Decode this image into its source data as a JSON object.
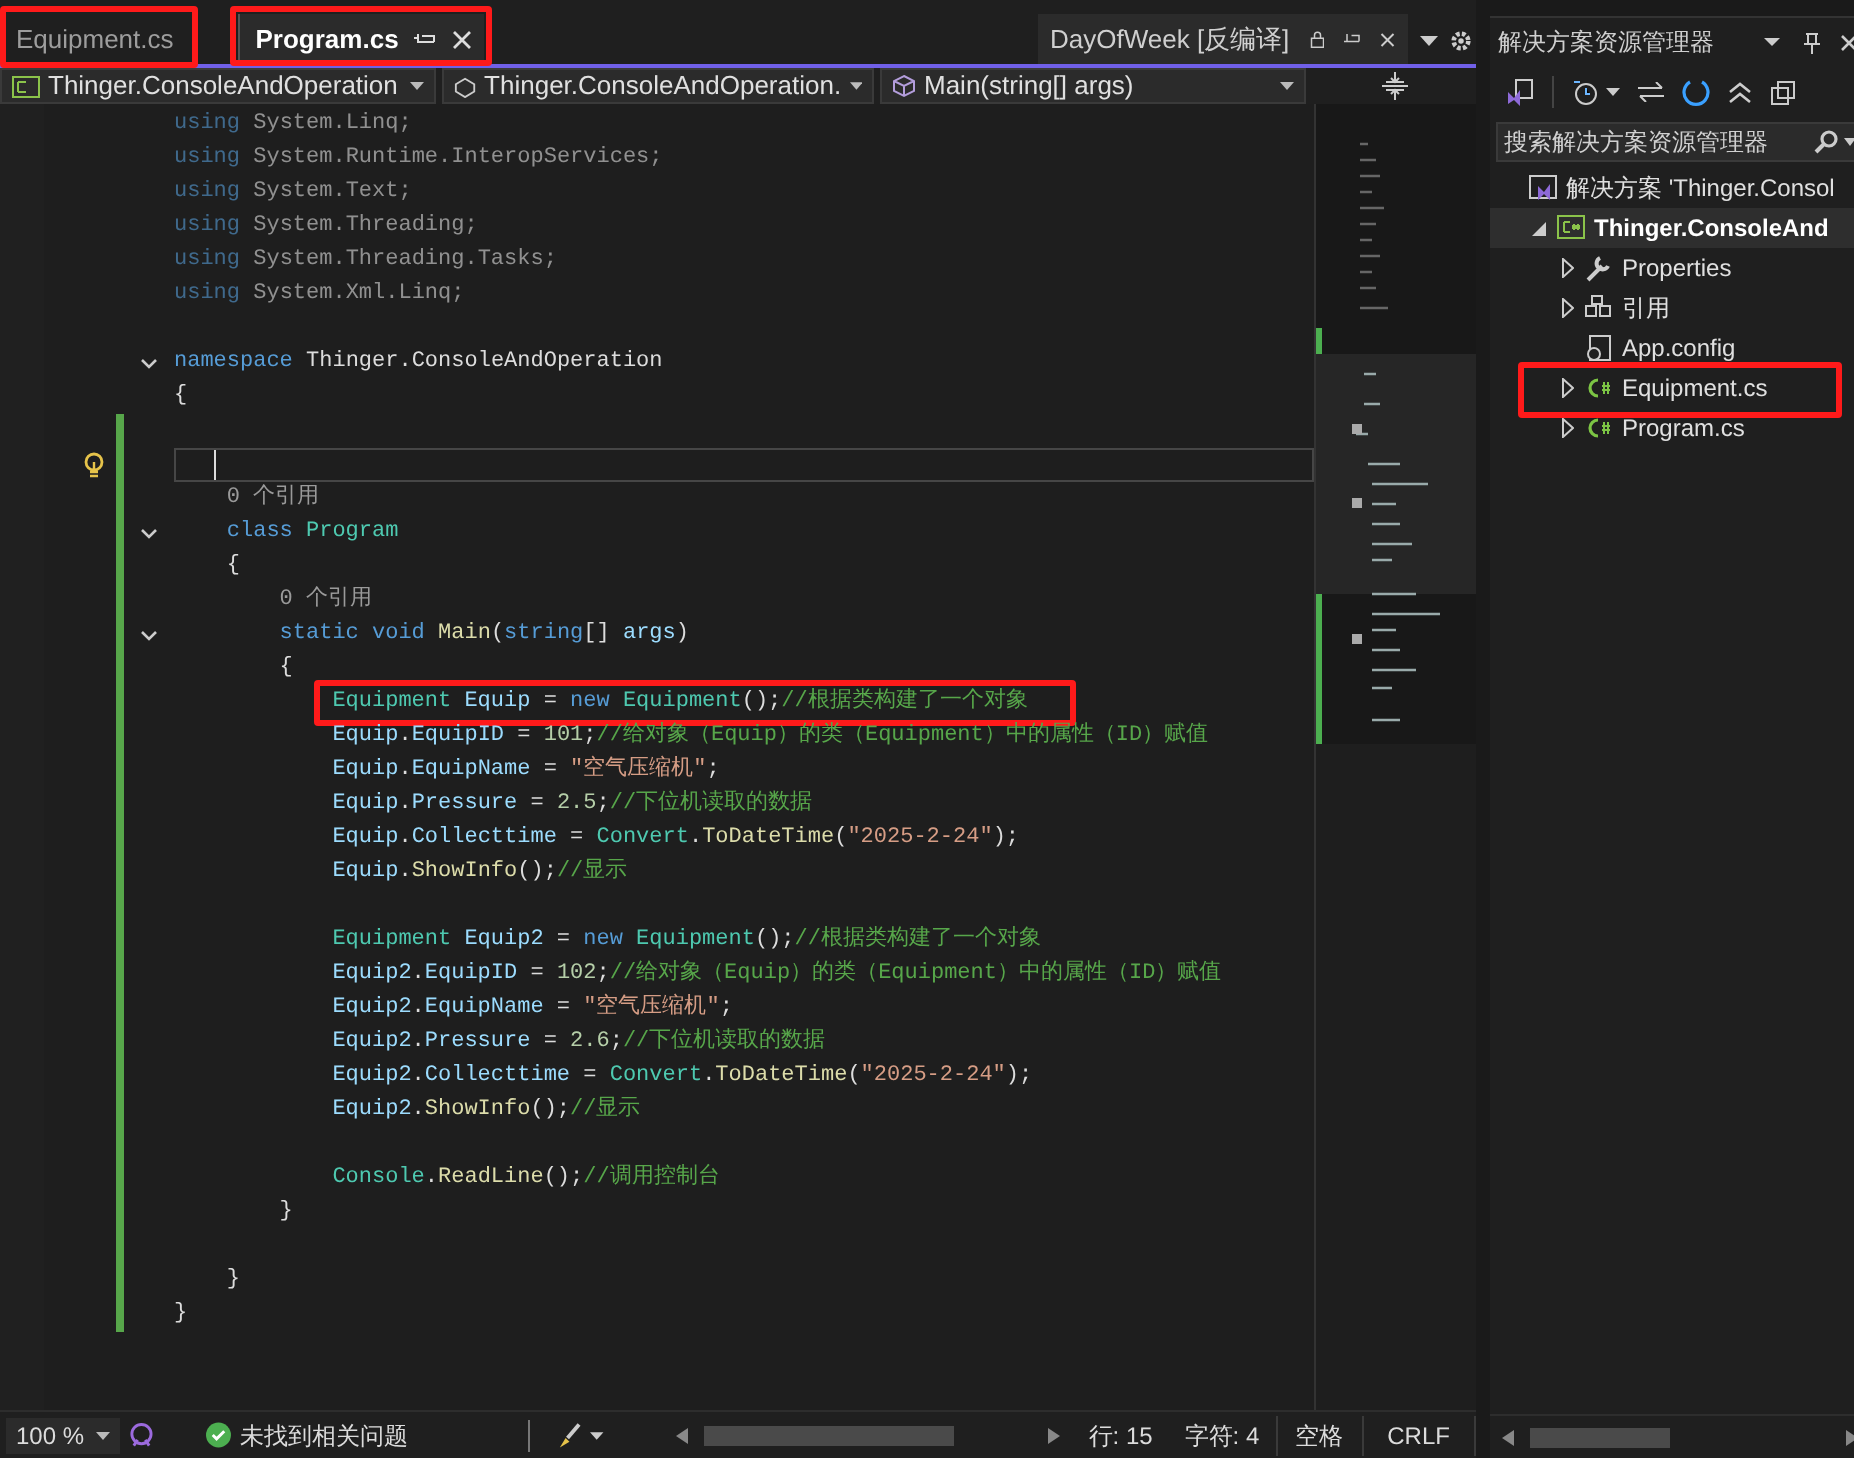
{
  "editor_tabs": [
    {
      "label": "Equipment.cs",
      "selected": false,
      "annotated": true
    },
    {
      "label": "Program.cs",
      "selected": true,
      "annotated": true
    }
  ],
  "preview_tab": {
    "label": "DayOfWeek [反编译]"
  },
  "navigation": [
    "Thinger.ConsoleAndOperation",
    "Thinger.ConsoleAndOperation.",
    "Main(string[] args)"
  ],
  "code": [
    {
      "kind": "code",
      "dimmed": true,
      "tokens": [
        {
          "kind": "keyword",
          "text": "using"
        },
        {
          "kind": "plain",
          "text": " System.Linq;"
        }
      ]
    },
    {
      "kind": "code",
      "dimmed": true,
      "tokens": [
        {
          "kind": "keyword",
          "text": "using"
        },
        {
          "kind": "plain",
          "text": " System.Runtime.InteropServices;"
        }
      ]
    },
    {
      "kind": "code",
      "dimmed": true,
      "tokens": [
        {
          "kind": "keyword",
          "text": "using"
        },
        {
          "kind": "plain",
          "text": " System.Text;"
        }
      ]
    },
    {
      "kind": "code",
      "dimmed": true,
      "tokens": [
        {
          "kind": "keyword",
          "text": "using"
        },
        {
          "kind": "plain",
          "text": " System.Threading;"
        }
      ]
    },
    {
      "kind": "code",
      "dimmed": true,
      "tokens": [
        {
          "kind": "keyword",
          "text": "using"
        },
        {
          "kind": "plain",
          "text": " System.Threading.Tasks;"
        }
      ]
    },
    {
      "kind": "code",
      "dimmed": true,
      "tokens": [
        {
          "kind": "keyword",
          "text": "using"
        },
        {
          "kind": "plain",
          "text": " System.Xml.Linq;"
        }
      ]
    },
    {
      "kind": "blank"
    },
    {
      "kind": "code",
      "fold": true,
      "tokens": [
        {
          "kind": "keyword",
          "text": "namespace"
        },
        {
          "kind": "plain",
          "text": " Thinger.ConsoleAndOperation"
        }
      ]
    },
    {
      "kind": "code",
      "tokens": [
        {
          "kind": "plain",
          "text": "{"
        }
      ],
      "children": [
        {
          "kind": "blank",
          "changed": true
        },
        {
          "kind": "blank",
          "changed": true,
          "current": true
        },
        {
          "kind": "lens",
          "changed": true,
          "text": "0 个引用"
        },
        {
          "kind": "code",
          "changed": true,
          "fold": true,
          "tokens": [
            {
              "kind": "keyword",
              "text": "class"
            },
            {
              "kind": "type",
              "text": " Program"
            }
          ]
        },
        {
          "kind": "code",
          "changed": true,
          "tokens": [
            {
              "kind": "plain",
              "text": "{"
            }
          ],
          "children": [
            {
              "kind": "lens",
              "changed": true,
              "text": "0 个引用"
            },
            {
              "kind": "code",
              "changed": true,
              "fold": true,
              "tokens": [
                {
                  "kind": "keyword",
                  "text": "static"
                },
                {
                  "kind": "keyword",
                  "text": " void"
                },
                {
                  "kind": "method",
                  "text": " Main"
                },
                {
                  "kind": "plain",
                  "text": "("
                },
                {
                  "kind": "keyword",
                  "text": "string"
                },
                {
                  "kind": "plain",
                  "text": "[] "
                },
                {
                  "kind": "ident",
                  "text": "args"
                },
                {
                  "kind": "plain",
                  "text": ")"
                }
              ]
            },
            {
              "kind": "code",
              "changed": true,
              "tokens": [
                {
                  "kind": "plain",
                  "text": "{"
                }
              ],
              "children": [
                {
                  "kind": "code",
                  "changed": true,
                  "annotated": true,
                  "tokens": [
                    {
                      "kind": "type",
                      "text": "Equipment"
                    },
                    {
                      "kind": "ident",
                      "text": " Equip"
                    },
                    {
                      "kind": "plain",
                      "text": " = "
                    },
                    {
                      "kind": "keyword",
                      "text": "new"
                    },
                    {
                      "kind": "type",
                      "text": " Equipment"
                    },
                    {
                      "kind": "plain",
                      "text": "();"
                    },
                    {
                      "kind": "comment",
                      "text": "//根据类构建了一个对象"
                    }
                  ]
                },
                {
                  "kind": "code",
                  "changed": true,
                  "tokens": [
                    {
                      "kind": "ident",
                      "text": "Equip"
                    },
                    {
                      "kind": "plain",
                      "text": "."
                    },
                    {
                      "kind": "ident",
                      "text": "EquipID"
                    },
                    {
                      "kind": "plain",
                      "text": " = "
                    },
                    {
                      "kind": "number",
                      "text": "101"
                    },
                    {
                      "kind": "plain",
                      "text": ";"
                    },
                    {
                      "kind": "comment",
                      "text": "//给对象（Equip）的类（Equipment）中的属性（ID）赋值"
                    }
                  ]
                },
                {
                  "kind": "code",
                  "changed": true,
                  "tokens": [
                    {
                      "kind": "ident",
                      "text": "Equip"
                    },
                    {
                      "kind": "plain",
                      "text": "."
                    },
                    {
                      "kind": "ident",
                      "text": "EquipName"
                    },
                    {
                      "kind": "plain",
                      "text": " = "
                    },
                    {
                      "kind": "string",
                      "text": "\"空气压缩机\""
                    },
                    {
                      "kind": "plain",
                      "text": ";"
                    }
                  ]
                },
                {
                  "kind": "code",
                  "changed": true,
                  "tokens": [
                    {
                      "kind": "ident",
                      "text": "Equip"
                    },
                    {
                      "kind": "plain",
                      "text": "."
                    },
                    {
                      "kind": "ident",
                      "text": "Pressure"
                    },
                    {
                      "kind": "plain",
                      "text": " = "
                    },
                    {
                      "kind": "number",
                      "text": "2.5"
                    },
                    {
                      "kind": "plain",
                      "text": ";"
                    },
                    {
                      "kind": "comment",
                      "text": "//下位机读取的数据"
                    }
                  ]
                },
                {
                  "kind": "code",
                  "changed": true,
                  "tokens": [
                    {
                      "kind": "ident",
                      "text": "Equip"
                    },
                    {
                      "kind": "plain",
                      "text": "."
                    },
                    {
                      "kind": "ident",
                      "text": "Collecttime"
                    },
                    {
                      "kind": "plain",
                      "text": " = "
                    },
                    {
                      "kind": "type",
                      "text": "Convert"
                    },
                    {
                      "kind": "plain",
                      "text": "."
                    },
                    {
                      "kind": "method",
                      "text": "ToDateTime"
                    },
                    {
                      "kind": "plain",
                      "text": "("
                    },
                    {
                      "kind": "string",
                      "text": "\"2025-2-24\""
                    },
                    {
                      "kind": "plain",
                      "text": ");"
                    }
                  ]
                },
                {
                  "kind": "code",
                  "changed": true,
                  "tokens": [
                    {
                      "kind": "ident",
                      "text": "Equip"
                    },
                    {
                      "kind": "plain",
                      "text": "."
                    },
                    {
                      "kind": "method",
                      "text": "ShowInfo"
                    },
                    {
                      "kind": "plain",
                      "text": "();"
                    },
                    {
                      "kind": "comment",
                      "text": "//显示"
                    }
                  ]
                },
                {
                  "kind": "blank",
                  "changed": true
                },
                {
                  "kind": "code",
                  "changed": true,
                  "tokens": [
                    {
                      "kind": "type",
                      "text": "Equipment"
                    },
                    {
                      "kind": "ident",
                      "text": " Equip2"
                    },
                    {
                      "kind": "plain",
                      "text": " = "
                    },
                    {
                      "kind": "keyword",
                      "text": "new"
                    },
                    {
                      "kind": "type",
                      "text": " Equipment"
                    },
                    {
                      "kind": "plain",
                      "text": "();"
                    },
                    {
                      "kind": "comment",
                      "text": "//根据类构建了一个对象"
                    }
                  ]
                },
                {
                  "kind": "code",
                  "changed": true,
                  "tokens": [
                    {
                      "kind": "ident",
                      "text": "Equip2"
                    },
                    {
                      "kind": "plain",
                      "text": "."
                    },
                    {
                      "kind": "ident",
                      "text": "EquipID"
                    },
                    {
                      "kind": "plain",
                      "text": " = "
                    },
                    {
                      "kind": "number",
                      "text": "102"
                    },
                    {
                      "kind": "plain",
                      "text": ";"
                    },
                    {
                      "kind": "comment",
                      "text": "//给对象（Equip）的类（Equipment）中的属性（ID）赋值"
                    }
                  ]
                },
                {
                  "kind": "code",
                  "changed": true,
                  "tokens": [
                    {
                      "kind": "ident",
                      "text": "Equip2"
                    },
                    {
                      "kind": "plain",
                      "text": "."
                    },
                    {
                      "kind": "ident",
                      "text": "EquipName"
                    },
                    {
                      "kind": "plain",
                      "text": " = "
                    },
                    {
                      "kind": "string",
                      "text": "\"空气压缩机\""
                    },
                    {
                      "kind": "plain",
                      "text": ";"
                    }
                  ]
                },
                {
                  "kind": "code",
                  "changed": true,
                  "tokens": [
                    {
                      "kind": "ident",
                      "text": "Equip2"
                    },
                    {
                      "kind": "plain",
                      "text": "."
                    },
                    {
                      "kind": "ident",
                      "text": "Pressure"
                    },
                    {
                      "kind": "plain",
                      "text": " = "
                    },
                    {
                      "kind": "number",
                      "text": "2.6"
                    },
                    {
                      "kind": "plain",
                      "text": ";"
                    },
                    {
                      "kind": "comment",
                      "text": "//下位机读取的数据"
                    }
                  ]
                },
                {
                  "kind": "code",
                  "changed": true,
                  "tokens": [
                    {
                      "kind": "ident",
                      "text": "Equip2"
                    },
                    {
                      "kind": "plain",
                      "text": "."
                    },
                    {
                      "kind": "ident",
                      "text": "Collecttime"
                    },
                    {
                      "kind": "plain",
                      "text": " = "
                    },
                    {
                      "kind": "type",
                      "text": "Convert"
                    },
                    {
                      "kind": "plain",
                      "text": "."
                    },
                    {
                      "kind": "method",
                      "text": "ToDateTime"
                    },
                    {
                      "kind": "plain",
                      "text": "("
                    },
                    {
                      "kind": "string",
                      "text": "\"2025-2-24\""
                    },
                    {
                      "kind": "plain",
                      "text": ");"
                    }
                  ]
                },
                {
                  "kind": "code",
                  "changed": true,
                  "tokens": [
                    {
                      "kind": "ident",
                      "text": "Equip2"
                    },
                    {
                      "kind": "plain",
                      "text": "."
                    },
                    {
                      "kind": "method",
                      "text": "ShowInfo"
                    },
                    {
                      "kind": "plain",
                      "text": "();"
                    },
                    {
                      "kind": "comment",
                      "text": "//显示"
                    }
                  ]
                },
                {
                  "kind": "blank",
                  "changed": true
                },
                {
                  "kind": "code",
                  "changed": true,
                  "tokens": [
                    {
                      "kind": "type",
                      "text": "Console"
                    },
                    {
                      "kind": "plain",
                      "text": "."
                    },
                    {
                      "kind": "method",
                      "text": "ReadLine"
                    },
                    {
                      "kind": "plain",
                      "text": "();"
                    },
                    {
                      "kind": "comment",
                      "text": "//调用控制台"
                    }
                  ]
                }
              ]
            },
            {
              "kind": "code",
              "changed": true,
              "tokens": [
                {
                  "kind": "plain",
                  "text": "}"
                }
              ]
            },
            {
              "kind": "blank",
              "changed": true
            }
          ]
        },
        {
          "kind": "code",
          "changed": true,
          "tokens": [
            {
              "kind": "plain",
              "text": "}"
            }
          ]
        }
      ]
    },
    {
      "kind": "code",
      "changed": true,
      "tokens": [
        {
          "kind": "plain",
          "text": "}"
        }
      ]
    }
  ],
  "status_bar": {
    "zoom": "100 %",
    "issues": "未找到相关问题",
    "line": "行: 15",
    "column": "字符: 4",
    "indent": "空格",
    "line_ending": "CRLF"
  },
  "solution_explorer": {
    "title": "解决方案资源管理器",
    "search": {
      "placeholder": "搜索解决方案资源管理器"
    },
    "tree": [
      {
        "label": "解决方案 'Thinger.Consol",
        "kind": "solution",
        "selected": false,
        "children": [
          {
            "label": "Thinger.ConsoleAnd",
            "kind": "project",
            "expanded": true,
            "selected": true,
            "children": [
              {
                "label": "Properties",
                "kind": "properties",
                "expanded": false,
                "selected": false
              },
              {
                "label": "引用",
                "kind": "references",
                "expanded": false,
                "selected": false
              },
              {
                "label": "App.config",
                "kind": "config",
                "selected": false
              },
              {
                "label": "Equipment.cs",
                "kind": "csharp",
                "expanded": false,
                "selected": false,
                "annotated": true
              },
              {
                "label": "Program.cs",
                "kind": "csharp",
                "expanded": false,
                "selected": false
              }
            ]
          }
        ]
      }
    ]
  }
}
